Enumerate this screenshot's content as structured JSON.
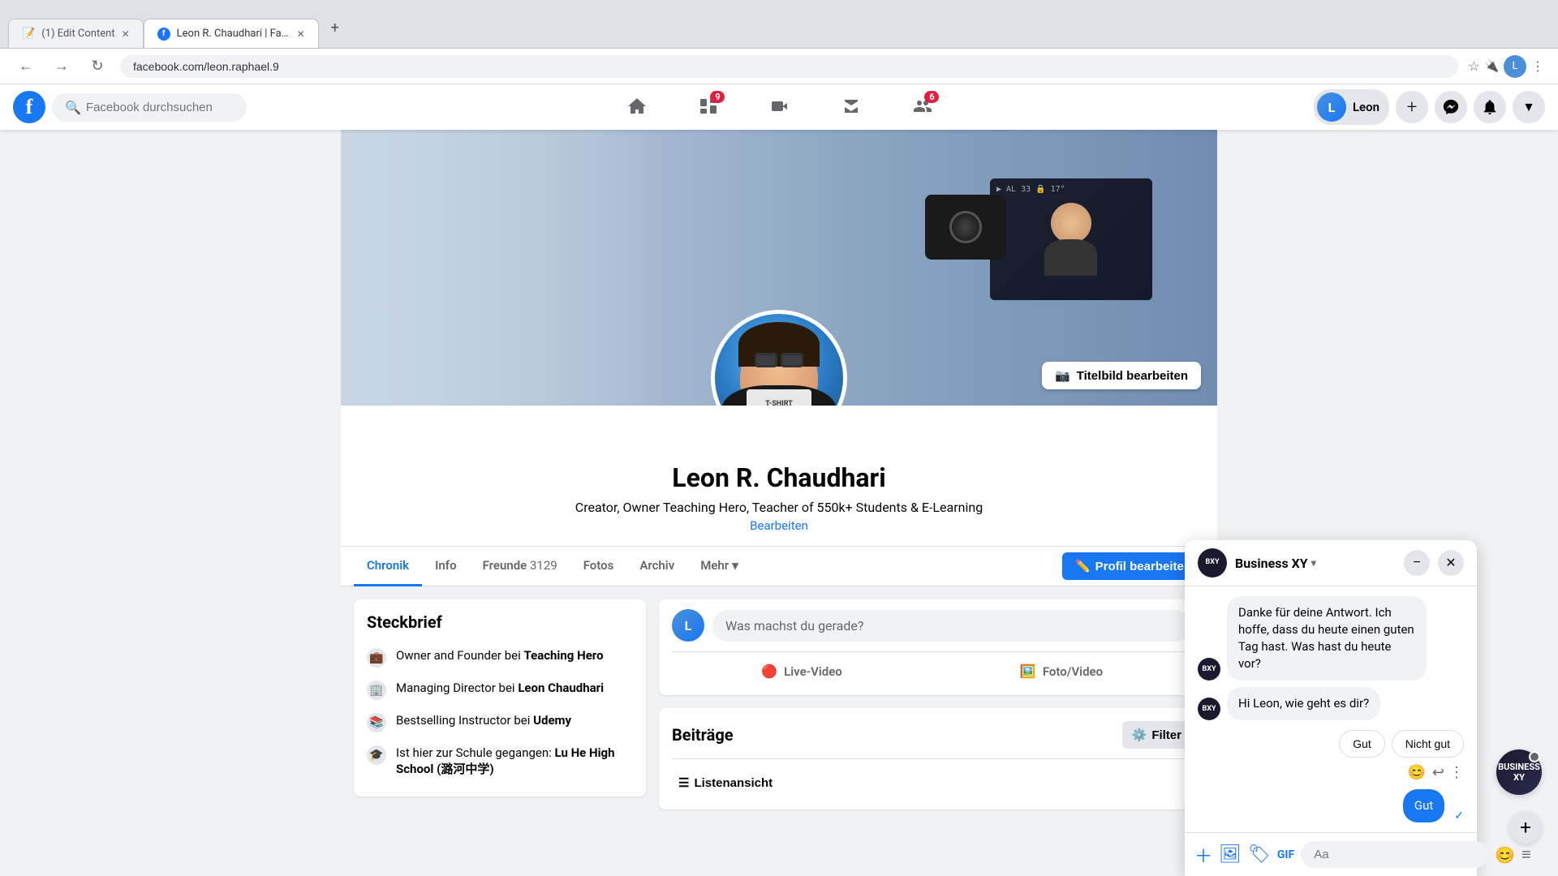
{
  "browser": {
    "tabs": [
      {
        "id": "tab1",
        "label": "(1) Edit Content",
        "active": false,
        "favicon": "📝"
      },
      {
        "id": "tab2",
        "label": "Leon R. Chaudhari | Facebook",
        "active": true,
        "favicon": "🔵"
      }
    ],
    "url": "facebook.com/leon.raphael.9"
  },
  "navbar": {
    "search_placeholder": "Facebook durchsuchen",
    "user_name": "Leon",
    "notifications": {
      "feed": "9",
      "groups": "6"
    }
  },
  "profile": {
    "name": "Leon R. Chaudhari",
    "bio": "Creator, Owner Teaching Hero, Teacher of 550k+ Students & E-Learning",
    "edit_link": "Bearbeiten",
    "cover_edit_btn": "Titelbild bearbeiten",
    "tabs": [
      {
        "id": "chronik",
        "label": "Chronik",
        "active": true
      },
      {
        "id": "info",
        "label": "Info",
        "active": false
      },
      {
        "id": "freunde",
        "label": "Freunde",
        "active": false
      },
      {
        "id": "fotos",
        "label": "Fotos",
        "active": false
      },
      {
        "id": "archiv",
        "label": "Archiv",
        "active": false
      },
      {
        "id": "mehr",
        "label": "Mehr",
        "active": false
      }
    ],
    "freunde_count": "3129",
    "profil_bearbeiten": "Profil bearbeiten"
  },
  "steckbrief": {
    "title": "Steckbrief",
    "items": [
      {
        "icon": "briefcase",
        "text": "Owner and Founder bei ",
        "bold": "Teaching Hero"
      },
      {
        "icon": "building",
        "text": "Managing Director bei ",
        "bold": "Leon Chaudhari"
      },
      {
        "icon": "book",
        "text": "Bestselling Instructor bei ",
        "bold": "Udemy"
      },
      {
        "icon": "school",
        "text": "Ist hier zur Schule gegangen: ",
        "bold": "Lu He High School (潞河中学)"
      }
    ]
  },
  "post_box": {
    "placeholder": "Was machst du gerade?",
    "live_video": "Live-Video",
    "foto_video": "Foto/Video"
  },
  "beitraege": {
    "title": "Beiträge",
    "filter_label": "Filter",
    "listenansicht": "Listenansicht"
  },
  "messenger": {
    "name": "Business XY",
    "messages": [
      {
        "id": "m1",
        "type": "received",
        "text": "Danke für deine Antwort. Ich hoffe, dass du heute einen guten Tag hast. Was hast du heute vor?"
      },
      {
        "id": "m2",
        "type": "received",
        "text": "Hi Leon, wie geht es dir?"
      },
      {
        "id": "m3",
        "type": "sent_suggestion",
        "options": [
          "Gut",
          "Nicht gut"
        ]
      }
    ],
    "sent_message": "Gut",
    "input_placeholder": "Aa",
    "minimize_btn": "−",
    "close_btn": "✕"
  },
  "bxy_label": "BUSINESS XY"
}
